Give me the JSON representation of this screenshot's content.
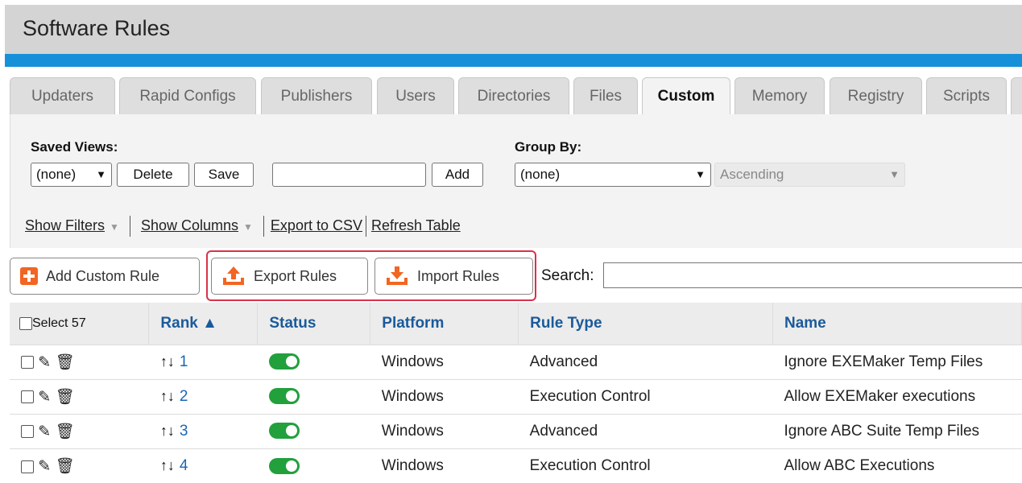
{
  "header": {
    "title": "Software Rules"
  },
  "tabs": [
    {
      "label": "Updaters"
    },
    {
      "label": "Rapid Configs"
    },
    {
      "label": "Publishers"
    },
    {
      "label": "Users"
    },
    {
      "label": "Directories"
    },
    {
      "label": "Files"
    },
    {
      "label": "Custom",
      "active": true
    },
    {
      "label": "Memory"
    },
    {
      "label": "Registry"
    },
    {
      "label": "Scripts"
    }
  ],
  "saved_views": {
    "label": "Saved Views:",
    "selected": "(none)",
    "delete_label": "Delete",
    "save_label": "Save",
    "new_view_value": "",
    "add_label": "Add"
  },
  "group_by": {
    "label": "Group By:",
    "selected": "(none)",
    "order_selected": "Ascending"
  },
  "links": {
    "show_filters": "Show Filters",
    "show_columns": "Show Columns",
    "export_csv": "Export to CSV",
    "refresh_table": "Refresh Table"
  },
  "toolbar": {
    "add_custom_rule": "Add Custom Rule",
    "export_rules": "Export Rules",
    "import_rules": "Import Rules",
    "search_label": "Search:",
    "search_value": ""
  },
  "colors": {
    "accent_blue": "#1690d8",
    "icon_orange": "#f26522",
    "toggle_green": "#21a03c",
    "highlight_red": "#d9314a"
  },
  "table": {
    "select_label": "Select 57",
    "columns": {
      "rank": "Rank ▲",
      "status": "Status",
      "platform": "Platform",
      "rule_type": "Rule Type",
      "name": "Name"
    },
    "rows": [
      {
        "rank": "1",
        "status": "on",
        "platform": "Windows",
        "rule_type": "Advanced",
        "name": "Ignore EXEMaker Temp Files"
      },
      {
        "rank": "2",
        "status": "on",
        "platform": "Windows",
        "rule_type": "Execution Control",
        "name": "Allow EXEMaker executions"
      },
      {
        "rank": "3",
        "status": "on",
        "platform": "Windows",
        "rule_type": "Advanced",
        "name": "Ignore ABC Suite Temp Files"
      },
      {
        "rank": "4",
        "status": "on",
        "platform": "Windows",
        "rule_type": "Execution Control",
        "name": "Allow ABC Executions"
      }
    ]
  }
}
